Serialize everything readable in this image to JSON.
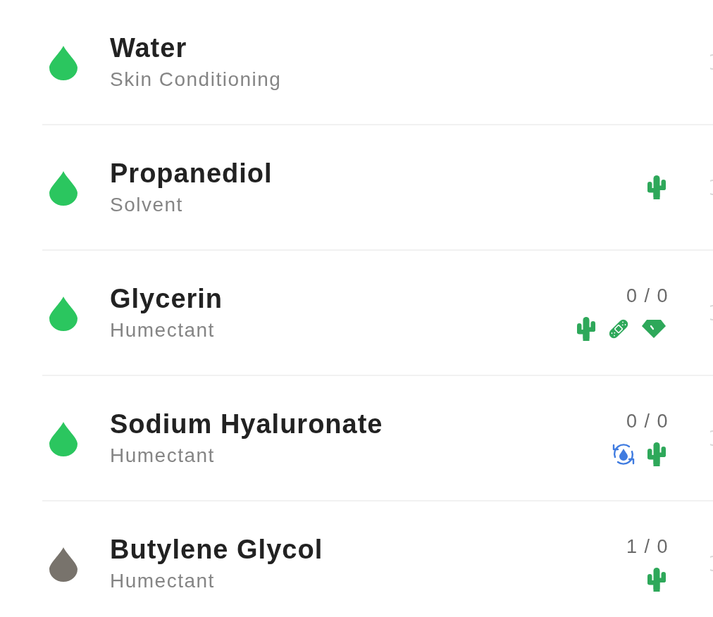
{
  "ingredients": [
    {
      "name": "Water",
      "function": "Skin Conditioning",
      "color": "#2bc65f"
    },
    {
      "name": "Propanediol",
      "function": "Solvent",
      "color": "#2bc65f",
      "icons": [
        {
          "kind": "cactus"
        }
      ]
    },
    {
      "name": "Glycerin",
      "function": "Humectant",
      "color": "#2bc65f",
      "counts": "0 / 0",
      "icons": [
        {
          "kind": "cactus"
        },
        {
          "kind": "bandage"
        },
        {
          "kind": "gem"
        }
      ]
    },
    {
      "name": "Sodium Hyaluronate",
      "function": "Humectant",
      "color": "#2bc65f",
      "counts": "0 / 0",
      "icons": [
        {
          "kind": "water-cycle"
        },
        {
          "kind": "cactus"
        }
      ]
    },
    {
      "name": "Butylene Glycol",
      "function": "Humectant",
      "color": "#78736c",
      "counts": "1 / 0",
      "icons": [
        {
          "kind": "cactus"
        }
      ]
    }
  ]
}
